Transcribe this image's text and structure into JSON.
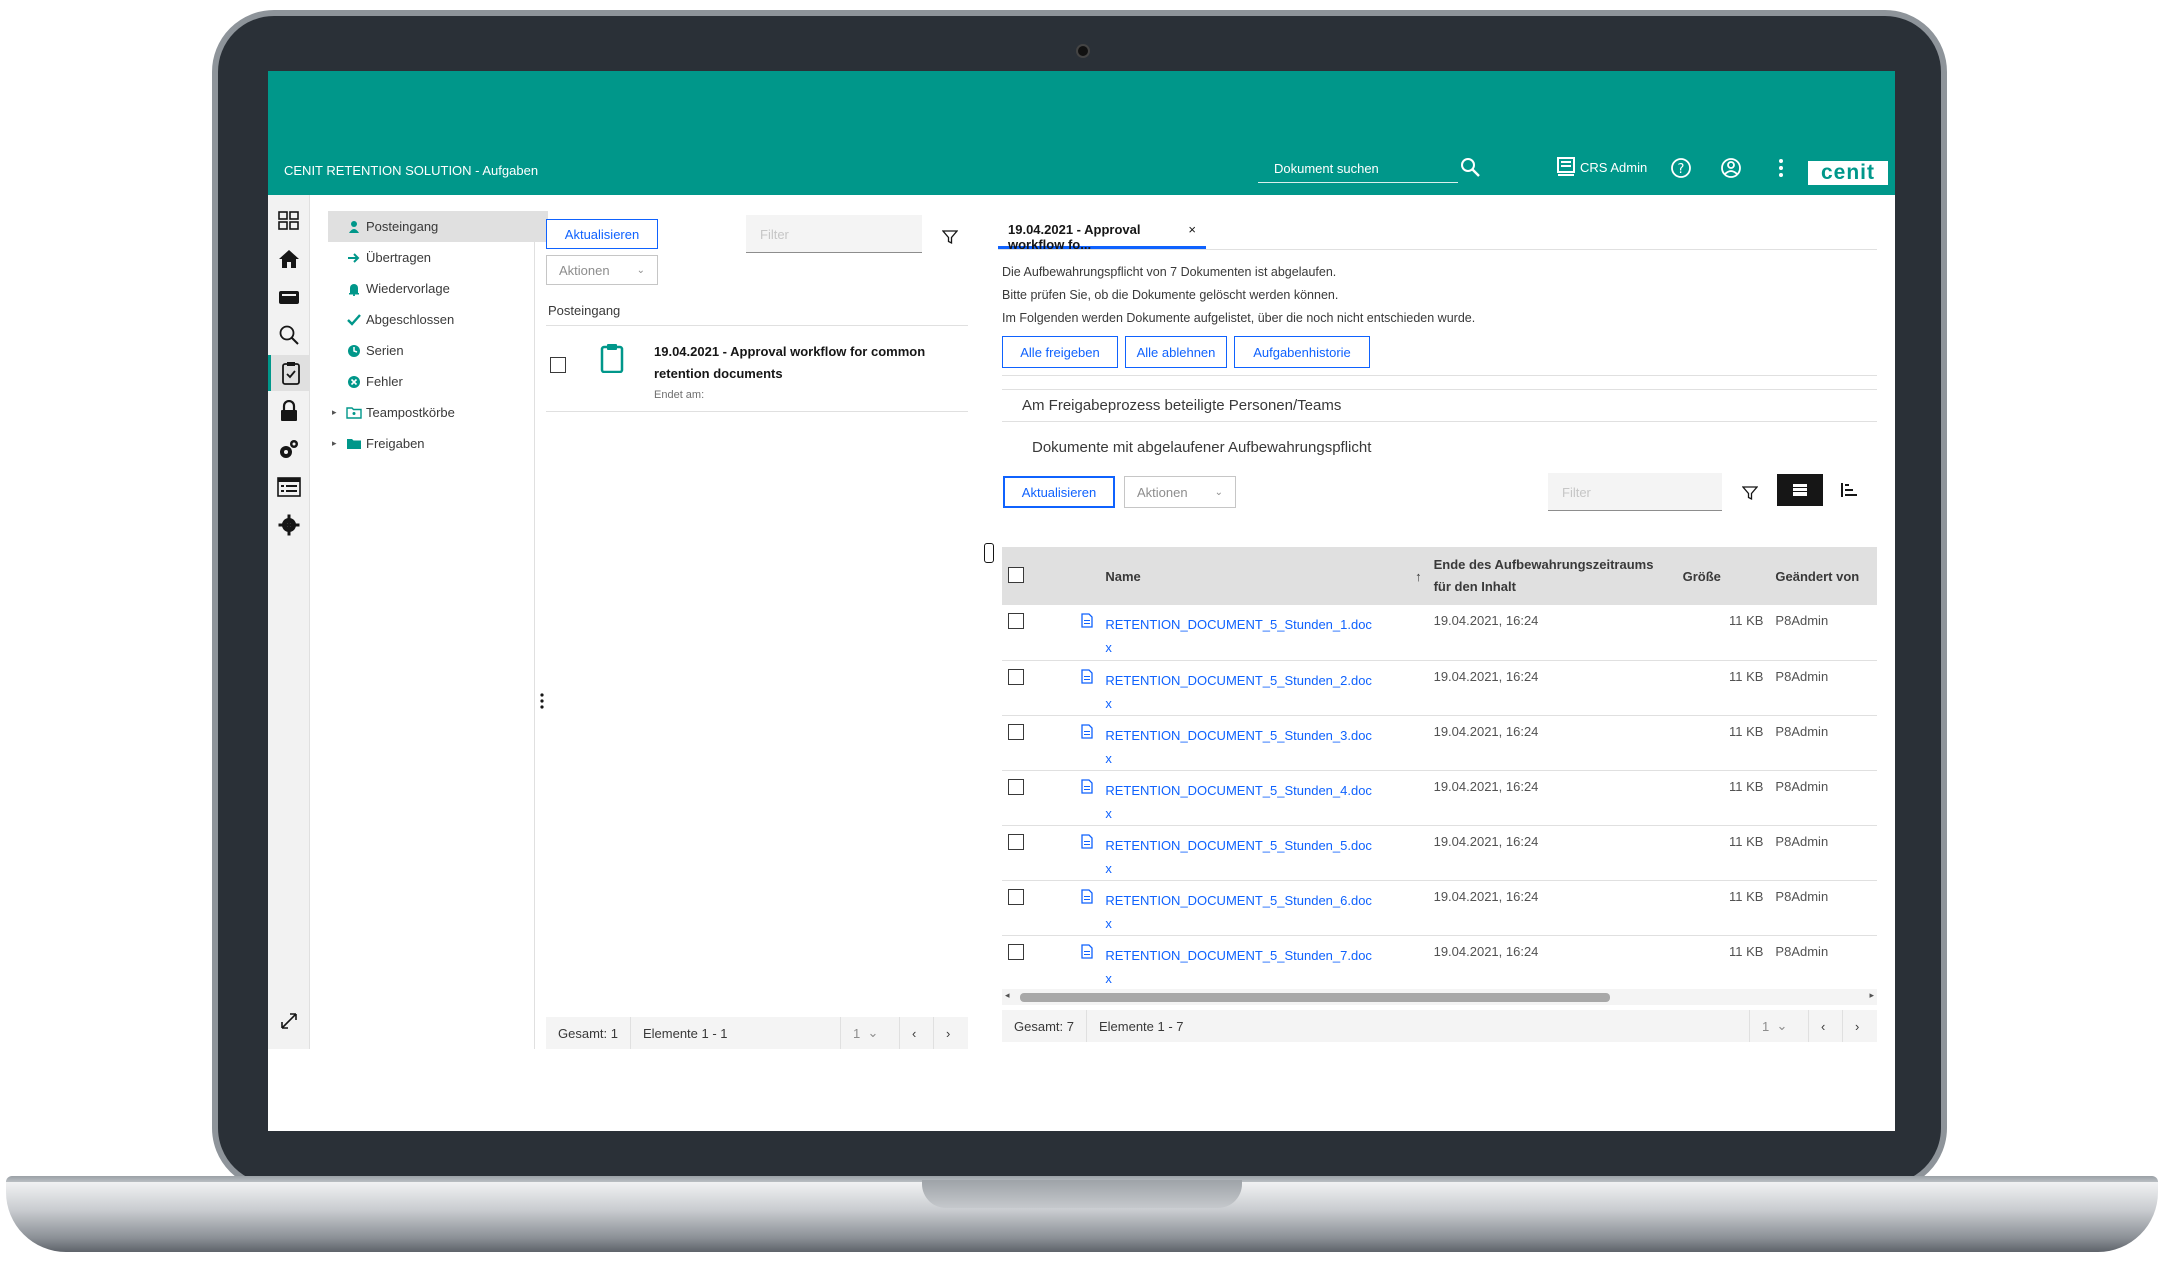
{
  "app": {
    "title": "CENIT RETENTION SOLUTION - Aufgaben",
    "search_placeholder": "Dokument suchen",
    "user_name": "CRS Admin",
    "logo_text": "cenit",
    "brand_color": "#00978a",
    "accent_color": "#0f62fe"
  },
  "rail": {
    "icons": [
      "grid-icon",
      "home-icon",
      "drawer-icon",
      "search-icon",
      "clipboard-icon",
      "lock-icon",
      "gears-icon",
      "form-icon",
      "settings-icon",
      "expand-icon"
    ]
  },
  "nav": {
    "items": [
      {
        "label": "Posteingang",
        "icon": "person-icon",
        "selected": true
      },
      {
        "label": "Übertragen",
        "icon": "arrow-right-icon"
      },
      {
        "label": "Wiedervorlage",
        "icon": "bell-icon"
      },
      {
        "label": "Abgeschlossen",
        "icon": "check-icon"
      },
      {
        "label": "Serien",
        "icon": "recurring-icon"
      },
      {
        "label": "Fehler",
        "icon": "error-icon"
      },
      {
        "label": "Teampostkörbe",
        "icon": "team-folder-icon"
      },
      {
        "label": "Freigaben",
        "icon": "folder-icon"
      }
    ]
  },
  "mid": {
    "refresh_label": "Aktualisieren",
    "actions_label": "Aktionen",
    "filter_placeholder": "Filter",
    "section_title": "Posteingang",
    "task": {
      "title": "19.04.2021 - Approval workflow for common retention documents",
      "subtitle": "Endet am:"
    },
    "footer": {
      "total": "Gesamt: 1",
      "elements": "Elemente 1 - 1",
      "page": "1"
    }
  },
  "detail": {
    "tab_label": "19.04.2021 - Approval workflow fo...",
    "tab_close": "×",
    "desc_lines": [
      "Die Aufbewahrungspflicht von 7 Dokumenten ist abgelaufen.",
      "Bitte prüfen Sie, ob die Dokumente gelöscht werden können.",
      "Im Folgenden werden Dokumente aufgelistet, über die noch nicht entschieden wurde."
    ],
    "buttons": {
      "approve_all": "Alle freigeben",
      "reject_all": "Alle ablehnen",
      "history": "Aufgabenhistorie"
    },
    "participants_title": "Am Freigabeprozess beteiligte Personen/Teams",
    "documents_title": "Dokumente mit abgelaufener Aufbewahrungspflicht",
    "refresh_label": "Aktualisieren",
    "actions_label": "Aktionen",
    "filter_placeholder": "Filter",
    "columns": {
      "name": "Name",
      "end": "Ende des Aufbewahrungszeitraums für den Inhalt",
      "size": "Größe",
      "modified_by": "Geändert von"
    },
    "rows": [
      {
        "name": "RETENTION_DOCUMENT_5_Stunden_1.docx",
        "end": "19.04.2021, 16:24",
        "size": "11 KB",
        "modified_by": "P8Admin"
      },
      {
        "name": "RETENTION_DOCUMENT_5_Stunden_2.docx",
        "end": "19.04.2021, 16:24",
        "size": "11 KB",
        "modified_by": "P8Admin"
      },
      {
        "name": "RETENTION_DOCUMENT_5_Stunden_3.docx",
        "end": "19.04.2021, 16:24",
        "size": "11 KB",
        "modified_by": "P8Admin"
      },
      {
        "name": "RETENTION_DOCUMENT_5_Stunden_4.docx",
        "end": "19.04.2021, 16:24",
        "size": "11 KB",
        "modified_by": "P8Admin"
      },
      {
        "name": "RETENTION_DOCUMENT_5_Stunden_5.docx",
        "end": "19.04.2021, 16:24",
        "size": "11 KB",
        "modified_by": "P8Admin"
      },
      {
        "name": "RETENTION_DOCUMENT_5_Stunden_6.docx",
        "end": "19.04.2021, 16:24",
        "size": "11 KB",
        "modified_by": "P8Admin"
      },
      {
        "name": "RETENTION_DOCUMENT_5_Stunden_7.docx",
        "end": "19.04.2021, 16:24",
        "size": "11 KB",
        "modified_by": "P8Admin"
      }
    ],
    "footer": {
      "total": "Gesamt: 7",
      "elements": "Elemente 1 - 7",
      "page": "1"
    }
  }
}
